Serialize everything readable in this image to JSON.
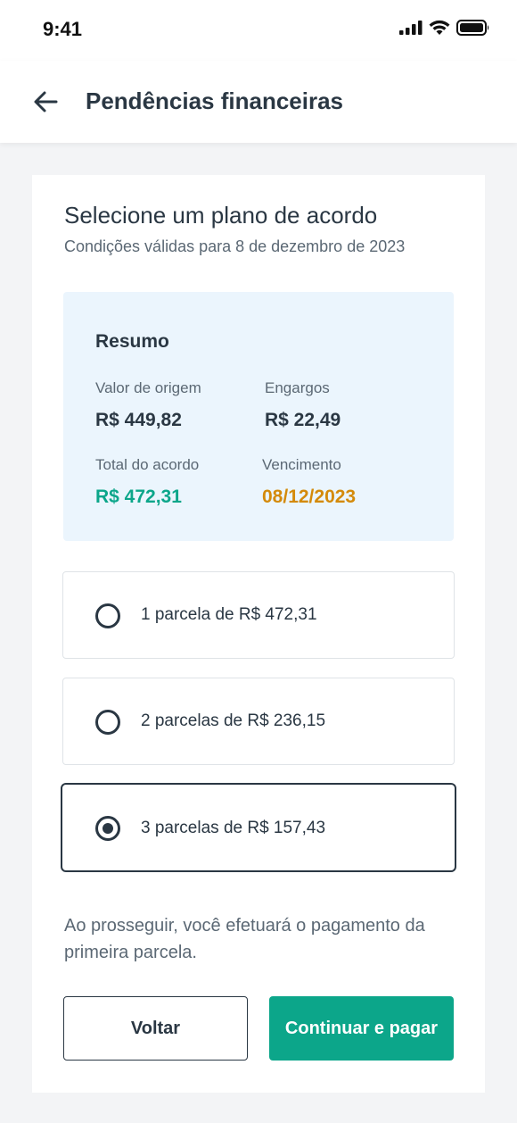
{
  "status_bar": {
    "time": "9:41"
  },
  "header": {
    "title": "Pendências financeiras",
    "back_icon": "arrow-left-icon"
  },
  "card": {
    "title": "Selecione um plano de acordo",
    "subtitle": "Condições válidas para 8 de dezembro de 2023"
  },
  "summary": {
    "title": "Resumo",
    "valor_origem_label": "Valor de origem",
    "valor_origem": "R$ 449,82",
    "encargos_label": "Engargos",
    "encargos": "R$ 22,49",
    "total_label": "Total do acordo",
    "total": "R$ 472,31",
    "vencimento_label": "Vencimento",
    "vencimento": "08/12/2023",
    "total_color": "#0ca68a",
    "vencimento_color": "#d48a0a"
  },
  "options": [
    {
      "label": "1 parcela de R$ 472,31",
      "selected": false
    },
    {
      "label": "2 parcelas de R$ 236,15",
      "selected": false
    },
    {
      "label": "3 parcelas de R$ 157,43",
      "selected": true
    }
  ],
  "notice": "Ao prosseguir, você efetuará o pagamento da primeira parcela.",
  "buttons": {
    "back": "Voltar",
    "continue": "Continuar e pagar"
  },
  "colors": {
    "primary": "#0ca68a",
    "text": "#2a3743",
    "summary_bg": "#ebf5fd"
  }
}
